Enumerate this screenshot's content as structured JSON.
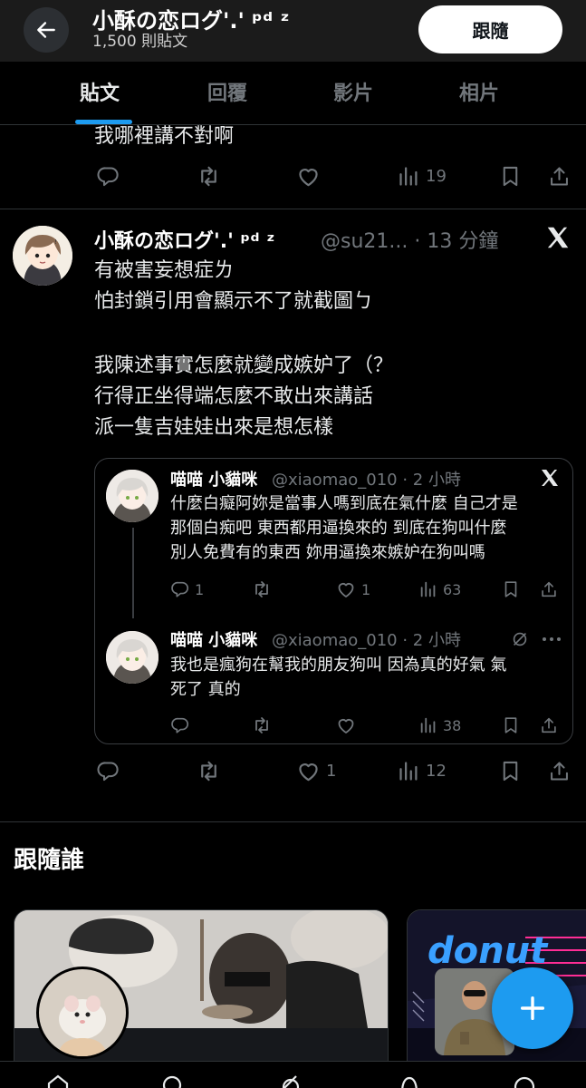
{
  "header": {
    "title": "小酥の恋ログ'.' ᵖᵈ ᶻ",
    "post_count": "1,500 則貼文",
    "follow_label": "跟隨"
  },
  "tabs": [
    {
      "label": "貼文",
      "active": true
    },
    {
      "label": "回覆",
      "active": false
    },
    {
      "label": "影片",
      "active": false
    },
    {
      "label": "相片",
      "active": false
    }
  ],
  "prev_tweet": {
    "text_tail": "我哪裡講不對啊",
    "views": "19"
  },
  "tweet": {
    "name": "小酥の恋ログ'.' ᵖᵈ ᶻ",
    "handle_time": "@su21... · 13 分鐘",
    "lines": [
      "有被害妄想症ㄌ",
      "怕封鎖引用會顯示不了就截圖ㄅ",
      "我陳述事實怎麼就變成嫉妒了（？",
      "行得正坐得端怎麼不敢出來講話",
      "派一隻吉娃娃出來是想怎樣"
    ],
    "likes": "1",
    "views": "12"
  },
  "quote": {
    "first": {
      "name": "喵喵 小貓咪",
      "handle_time": "@xiaomao_010 · 2 小時",
      "lines": [
        "什麼白癡阿妳是當事人嗎到底在氣什麼 自己才是",
        "那個白痴吧 東西都用逼換來的 到底在狗叫什麼",
        "別人免費有的東西 妳用逼換來嫉妒在狗叫嗎"
      ],
      "replies": "1",
      "likes": "1",
      "views": "63"
    },
    "second": {
      "name": "喵喵 小貓咪",
      "handle_time": "@xiaomao_010 · 2 小時",
      "lines": [
        "我也是瘋狗在幫我的朋友狗叫 因為真的好氣 氣",
        "死了 真的"
      ],
      "views": "38"
    }
  },
  "who_to_follow": {
    "title": "跟隨誰"
  },
  "icons": {
    "back": "arrow-left-icon",
    "x": "x-logo-icon",
    "reply": "reply-icon",
    "retweet": "retweet-icon",
    "like": "heart-icon",
    "views": "views-icon",
    "bookmark": "bookmark-icon",
    "share": "share-icon",
    "compose": "plus-icon"
  },
  "colors": {
    "accent": "#1d9bf0",
    "background": "#000000",
    "muted": "#71767b"
  }
}
